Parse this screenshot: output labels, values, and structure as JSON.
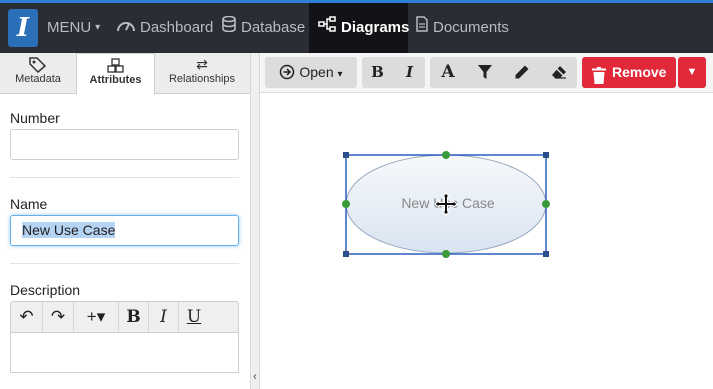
{
  "navbar": {
    "logo": "I",
    "items": [
      {
        "label": "MENU",
        "icon": "caret-down-icon"
      },
      {
        "label": "Dashboard",
        "icon": "dashboard-icon"
      },
      {
        "label": "Database",
        "icon": "database-icon"
      },
      {
        "label": "Diagrams",
        "icon": "sitemap-icon",
        "active": true
      },
      {
        "label": "Documents",
        "icon": "document-icon"
      }
    ]
  },
  "sidebar": {
    "tabs": [
      {
        "label": "Metadata",
        "icon": "tag-icon"
      },
      {
        "label": "Attributes",
        "icon": "cubes-icon",
        "active": true
      },
      {
        "label": "Relationships",
        "icon": "exchange-icon"
      }
    ],
    "fields": {
      "number": {
        "label": "Number",
        "value": ""
      },
      "name": {
        "label": "Name",
        "value": "New Use Case"
      },
      "description": {
        "label": "Description",
        "value": ""
      }
    },
    "editor_buttons": [
      {
        "glyph": "↶",
        "icon": "undo-icon"
      },
      {
        "glyph": "↷",
        "icon": "redo-icon"
      },
      {
        "glyph": "+▾",
        "icon": "insert-icon"
      },
      {
        "glyph": "B",
        "icon": "bold-icon"
      },
      {
        "glyph": "I",
        "icon": "italic-icon"
      },
      {
        "glyph": "U",
        "icon": "underline-icon"
      }
    ]
  },
  "toolbar": {
    "open_label": "Open",
    "remove_label": "Remove"
  },
  "canvas": {
    "shape": {
      "type": "use-case-ellipse",
      "label": "New Use Case",
      "selected": true
    }
  },
  "colors": {
    "accent": "#2f7fd6",
    "navbar": "#2a2d33",
    "danger": "#e1293a",
    "selection": "#2b5fbf",
    "handle_green": "#3a9a3a"
  }
}
